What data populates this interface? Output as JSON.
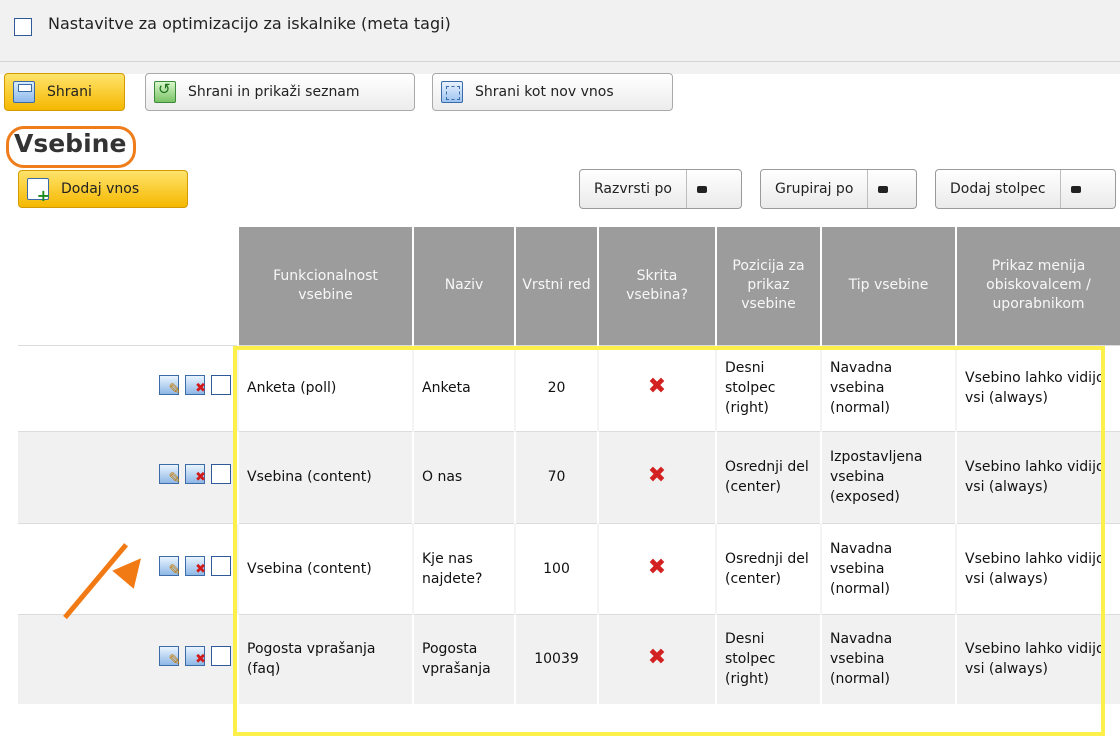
{
  "meta_section": {
    "label": "Nastavitve za optimizacijo za iskalnike (meta tagi)"
  },
  "toolbar": {
    "save": "Shrani",
    "save_and_list": "Shrani in prikaži seznam",
    "save_as_new": "Shrani kot nov vnos"
  },
  "section_title": "Vsebine",
  "add_entry": "Dodaj vnos",
  "controls": {
    "sort_by": "Razvrsti po",
    "group_by": "Grupiraj po",
    "add_column": "Dodaj stolpec"
  },
  "table": {
    "headers": [
      "Funkcionalnost vsebine",
      "Naziv",
      "Vrstni red",
      "Skrita vsebina?",
      "Pozicija za prikaz vsebine",
      "Tip vsebine",
      "Prikaz menija obiskovalcem / uporabnikom"
    ],
    "rows": [
      [
        "Anketa (poll)",
        "Anketa",
        "20",
        "✖",
        "Desni stolpec (right)",
        "Navadna vsebina (normal)",
        "Vsebino lahko vidijo vsi (always)"
      ],
      [
        "Vsebina (content)",
        "O nas",
        "70",
        "✖",
        "Osrednji del (center)",
        "Izpostavljena vsebina (exposed)",
        "Vsebino lahko vidijo vsi (always)"
      ],
      [
        "Vsebina (content)",
        "Kje nas najdete?",
        "100",
        "✖",
        "Osrednji del (center)",
        "Navadna vsebina (normal)",
        "Vsebino lahko vidijo vsi (always)"
      ],
      [
        "Pogosta vprašanja (faq)",
        "Pogosta vprašanja",
        "10039",
        "✖",
        "Desni stolpec (right)",
        "Navadna vsebina (normal)",
        "Vsebino lahko vidijo vsi (always)"
      ]
    ]
  },
  "colors": {
    "highlight": "#fdf04a",
    "annotation": "#f27a14",
    "header_bg": "#9c9c9c",
    "primary_button": "#f5b800"
  },
  "icons": [
    "edit-icon",
    "delete-icon",
    "row-checkbox",
    "hidden-x-icon"
  ]
}
